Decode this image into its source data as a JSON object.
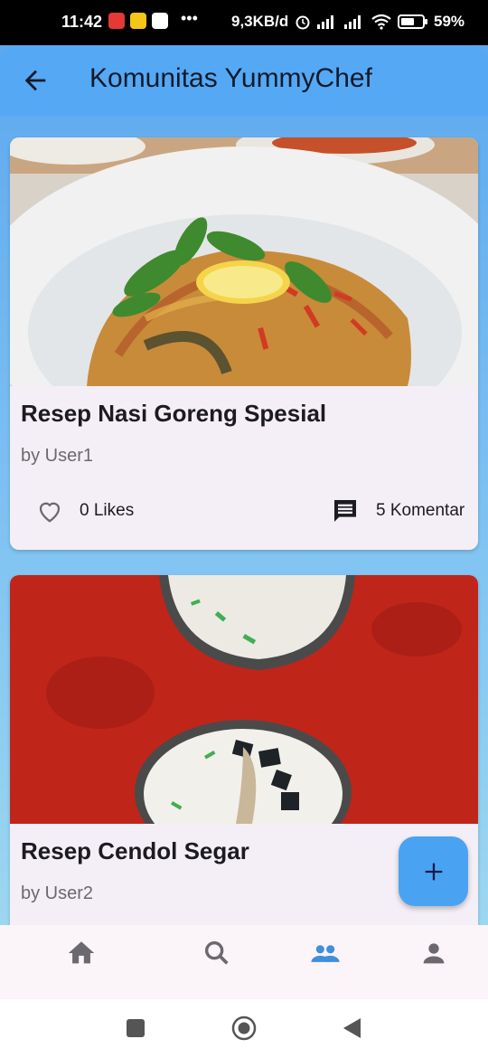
{
  "status_bar": {
    "time": "11:42",
    "network_speed": "9,3KB/d",
    "battery": "59%",
    "icons": [
      "notification-app-icon",
      "game-icon",
      "google-icon",
      "more-dots-icon",
      "alarm-icon",
      "signal-icon",
      "signal-icon",
      "wifi-icon",
      "battery-icon"
    ]
  },
  "app_bar": {
    "title": "Komunitas YummyChef",
    "back_icon": "arrow-back-icon"
  },
  "recipes": [
    {
      "title": "Resep Nasi Goreng Spesial",
      "author": "by User1",
      "likes": "0 Likes",
      "comments": "5 Komentar",
      "image": "fried-rice-photo"
    },
    {
      "title": "Resep Cendol Segar",
      "author": "by User2",
      "image": "cendol-photo"
    }
  ],
  "fab": {
    "icon": "plus-icon"
  },
  "bottom_nav": {
    "items": [
      "home-icon",
      "search-icon",
      "community-icon",
      "profile-icon"
    ],
    "active": "community-icon"
  },
  "system_nav": [
    "recent-apps-icon",
    "home-circle-icon",
    "back-triangle-icon"
  ],
  "colors": {
    "app_bar": "#55a8f3",
    "fab": "#4aa3f2",
    "active_nav": "#3f8fdc",
    "card_bg": "#f4eff6"
  }
}
